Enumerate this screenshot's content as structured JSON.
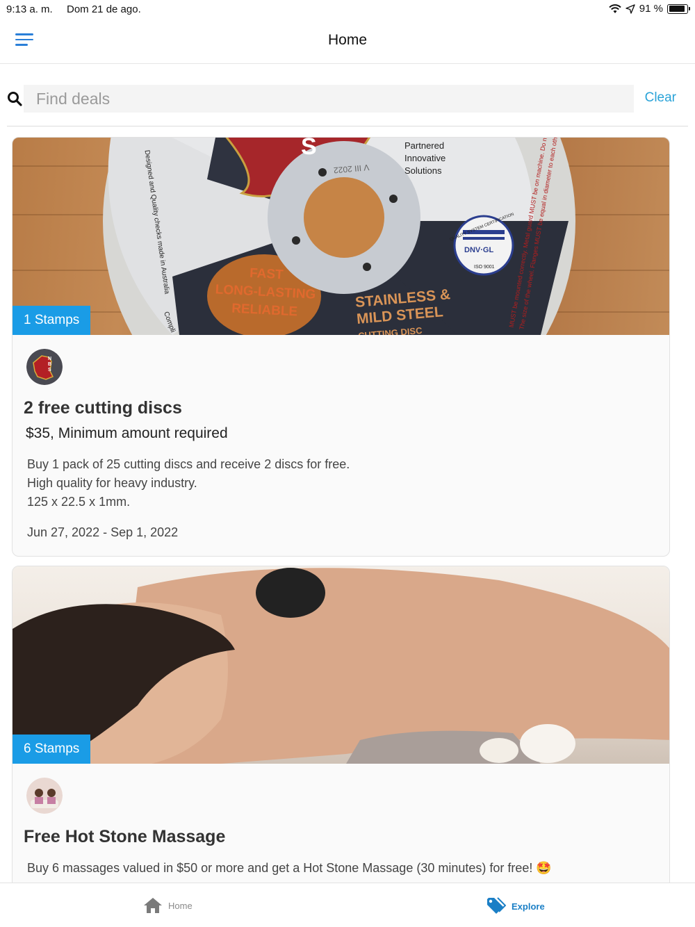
{
  "status_bar": {
    "time": "9:13 a. m.",
    "date": "Dom 21 de ago.",
    "battery": "91 %",
    "battery_level": 0.91
  },
  "nav": {
    "title": "Home",
    "menu_icon": "hamburger-menu-icon"
  },
  "search": {
    "placeholder": "Find deals",
    "value": "",
    "clear_label": "Clear",
    "icon": "search-icon"
  },
  "deals": [
    {
      "stamps_label": "1 Stamps",
      "title": "2 free cutting discs",
      "subtitle": "$35, Minimum amount required",
      "description": [
        "Buy 1 pack of 25 cutting discs and receive 2 discs for free.",
        "High quality for heavy industry.",
        "125 x 22.5 x 1mm."
      ],
      "dates": "Jun 27, 2022 - Sep 1, 2022",
      "image_text": {
        "brand_badge": "S",
        "partnered": [
          "Partnered",
          "Innovative",
          "Solutions"
        ],
        "ring_code": "V III 2022",
        "fast": [
          "FAST",
          "LONG-LASTING",
          "RELIABLE"
        ],
        "steel": [
          "STAINLESS &",
          "MILD STEEL",
          "CUTTING DISC"
        ],
        "cert": "DNV·GL",
        "iso": "ISO 9001",
        "cert_arc": "QUALITY SYSTEM CERTIFICATION",
        "left_edge": "Designed and Quality checks made in Australia",
        "left_edge_2": "Compli",
        "right_edge": "MUST be mounted correctly. Metal guard MUST be on machine. Do not",
        "right_edge_2": "The size of the wheel. Flanges MUST be equal in diameter to each other."
      },
      "avatar_text": "NBS"
    },
    {
      "stamps_label": "6 Stamps",
      "title": "Free Hot Stone Massage",
      "description": [
        "Buy 6 massages valued in $50 or more and get a Hot Stone Massage (30 minutes) for free! 🤩"
      ]
    }
  ],
  "tabs": [
    {
      "label": "Home",
      "icon": "home-icon",
      "active": false
    },
    {
      "label": "Explore",
      "icon": "tag-icon",
      "active": true
    }
  ],
  "colors": {
    "accent": "#1a9ce6",
    "menu": "#2a7fd8",
    "clear": "#2aa3d8",
    "tab_active": "#1b7fc6"
  }
}
